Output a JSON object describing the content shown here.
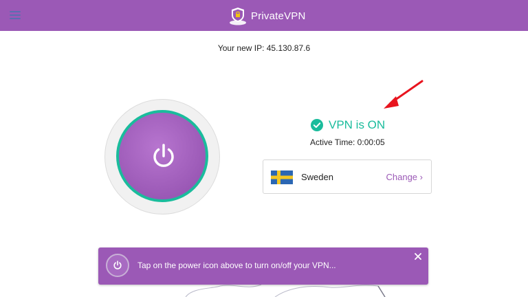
{
  "header": {
    "app_name": "PrivateVPN",
    "menu_icon": "hamburger-menu-icon",
    "logo_icon": "shield-logo-icon",
    "background": "#9b59b6"
  },
  "connection": {
    "ip_text": "Your new IP: 45.130.87.6",
    "status_text": "VPN is ON",
    "status_icon": "check-circle-icon",
    "status_color": "#1abc9c",
    "active_time": "Active Time: 0:00:05"
  },
  "location": {
    "country": "Sweden",
    "flag_icon": "sweden-flag-icon",
    "change_label": "Change"
  },
  "toast": {
    "message": "Tap on the power icon above to turn on/off your VPN...",
    "icon": "power-icon",
    "close_icon": "close-icon"
  },
  "colors": {
    "accent": "#9b59b6",
    "ring": "#1abc9c",
    "arrow": "#e8141e"
  }
}
